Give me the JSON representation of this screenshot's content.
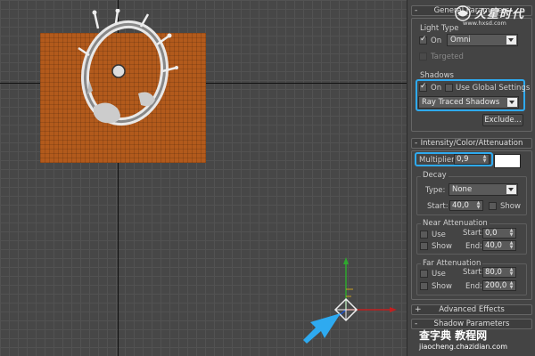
{
  "logo": {
    "text": "火星时代",
    "url": "www.hxsd.com"
  },
  "general": {
    "title": "General Parameters",
    "light_type_label": "Light Type",
    "on_label": "On",
    "light_type_value": "Omni",
    "targeted_label": "Targeted",
    "shadows_label": "Shadows",
    "shadows_on_label": "On",
    "use_global_label": "Use Global Settings",
    "shadow_type_value": "Ray Traced Shadows",
    "exclude_label": "Exclude..."
  },
  "intensity": {
    "title": "Intensity/Color/Attenuation",
    "multiplier_label": "Multiplier:",
    "multiplier_value": "0,9",
    "decay_label": "Decay",
    "type_label": "Type:",
    "type_value": "None",
    "start_label": "Start:",
    "start_value": "40,0",
    "show_label": "Show",
    "near_title": "Near Attenuation",
    "near_use_label": "Use",
    "near_start_label": "Start:",
    "near_start_value": "0,0",
    "near_show_label": "Show",
    "near_end_label": "End:",
    "near_end_value": "40,0",
    "far_title": "Far Attenuation",
    "far_use_label": "Use",
    "far_start_label": "Start:",
    "far_start_value": "80,0",
    "far_show_label": "Show",
    "far_end_label": "End:",
    "far_end_value": "200,0"
  },
  "advanced": {
    "title": "Advanced Effects",
    "toggle": "+"
  },
  "shadow_params": {
    "title": "Shadow Parameters",
    "toggle": "-"
  },
  "watermark": {
    "text": "查字典 教程网",
    "url": "jiaocheng.chazidian.com"
  },
  "colors": {
    "highlight": "#2eaaf0",
    "plane": "#b25a1c",
    "viewport_bg": "#474747"
  }
}
